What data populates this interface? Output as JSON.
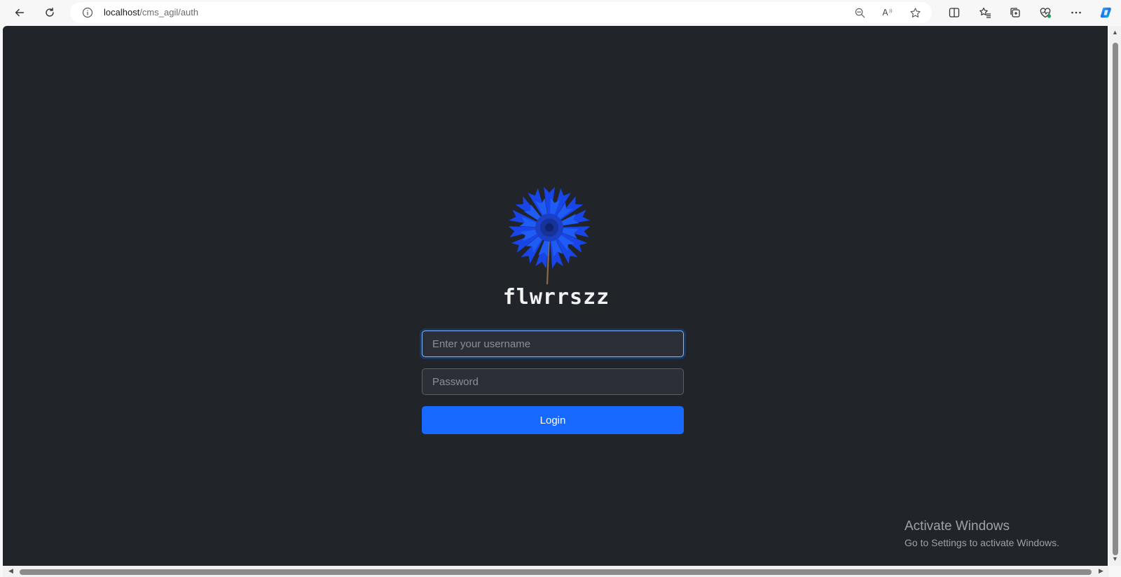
{
  "browser": {
    "url_host": "localhost",
    "url_path": "/cms_agil/auth",
    "read_aloud_label": "A",
    "icons": {
      "back": "back-arrow-icon",
      "refresh": "refresh-icon",
      "info": "info-icon",
      "zoom_out": "zoom-out-icon",
      "read_aloud": "read-aloud-icon",
      "favorite": "star-icon",
      "split_screen": "split-screen-icon",
      "favorites": "favorites-icon",
      "collections": "collections-icon",
      "health": "browser-essentials-icon",
      "more": "more-icon",
      "copilot": "copilot-icon"
    }
  },
  "login": {
    "brand": "flwrrszz",
    "username_placeholder": "Enter your username",
    "password_placeholder": "Password",
    "username_value": "",
    "password_value": "",
    "login_label": "Login",
    "logo_icon": "blue-flower-logo"
  },
  "watermark": {
    "title": "Activate Windows",
    "subtitle": "Go to Settings to activate Windows."
  },
  "colors": {
    "page_bg": "#212429",
    "accent": "#1769ff",
    "flower": "#1a4ff0"
  }
}
